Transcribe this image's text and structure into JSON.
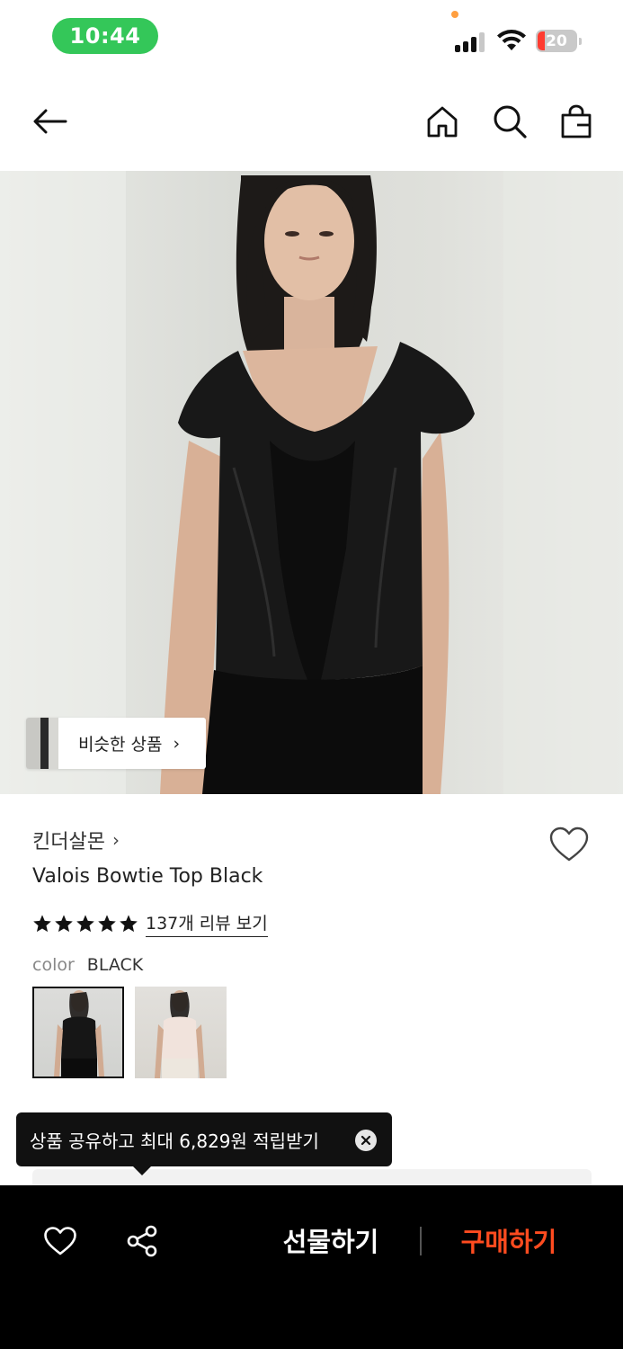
{
  "status_bar": {
    "time": "10:44",
    "battery": "20"
  },
  "nav": {
    "icons": [
      "back-arrow-icon",
      "home-icon",
      "search-icon",
      "shopping-bag-icon"
    ]
  },
  "hero": {
    "similar_products_label": "비슷한 상품"
  },
  "product": {
    "brand": "킨더살몬",
    "name": "Valois Bowtie Top Black",
    "rating_stars": 5,
    "review_link": "137개 리뷰 보기",
    "color_label": "color",
    "color_value": "BLACK",
    "swatches": [
      "black",
      "ivory"
    ]
  },
  "tooltip": {
    "text": "상품 공유하고 최대 6,829원 적립받기"
  },
  "bottom_bar": {
    "gift_label": "선물하기",
    "buy_label": "구매하기"
  },
  "colors": {
    "accent": "#ff4b1f",
    "status_green": "#34c759",
    "bar_bg": "#000000"
  }
}
